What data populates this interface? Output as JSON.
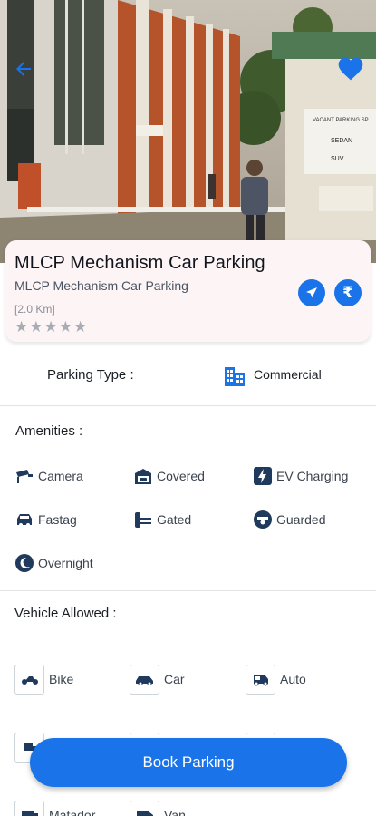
{
  "listing": {
    "title": "MLCP Mechanism Car Parking",
    "subtitle": "MLCP Mechanism Car Parking",
    "distance": "[2.0 Km]",
    "rating_stars": "★★★★★",
    "rating_value": 0,
    "rating_max": 5,
    "price_symbol": "₹"
  },
  "hero": {
    "sign_lines": [
      "VACANT PARKING SP",
      "SEDAN",
      "SUV"
    ]
  },
  "parking_type": {
    "label": "Parking Type :",
    "value": "Commercial"
  },
  "amenities": {
    "title": "Amenities :",
    "items": [
      {
        "label": "Camera",
        "icon": "camera-icon"
      },
      {
        "label": "Covered",
        "icon": "covered-garage-icon"
      },
      {
        "label": "EV Charging",
        "icon": "ev-charging-icon"
      },
      {
        "label": "Fastag",
        "icon": "fastag-icon"
      },
      {
        "label": "Gated",
        "icon": "gate-icon"
      },
      {
        "label": "Guarded",
        "icon": "guard-icon"
      },
      {
        "label": "Overnight",
        "icon": "overnight-icon"
      }
    ]
  },
  "vehicles": {
    "title": "Vehicle Allowed :",
    "items": [
      {
        "label": "Bike",
        "icon": "bike-icon"
      },
      {
        "label": "Car",
        "icon": "car-icon"
      },
      {
        "label": "Auto",
        "icon": "auto-rickshaw-icon"
      },
      {
        "label": "Matador",
        "icon": "matador-icon"
      },
      {
        "label": "Van",
        "icon": "van-icon"
      }
    ]
  },
  "actions": {
    "book_label": "Book Parking"
  },
  "colors": {
    "accent": "#1a73e8",
    "card_bg": "#fdf4f6",
    "icon_navy": "#1f3a5c"
  }
}
